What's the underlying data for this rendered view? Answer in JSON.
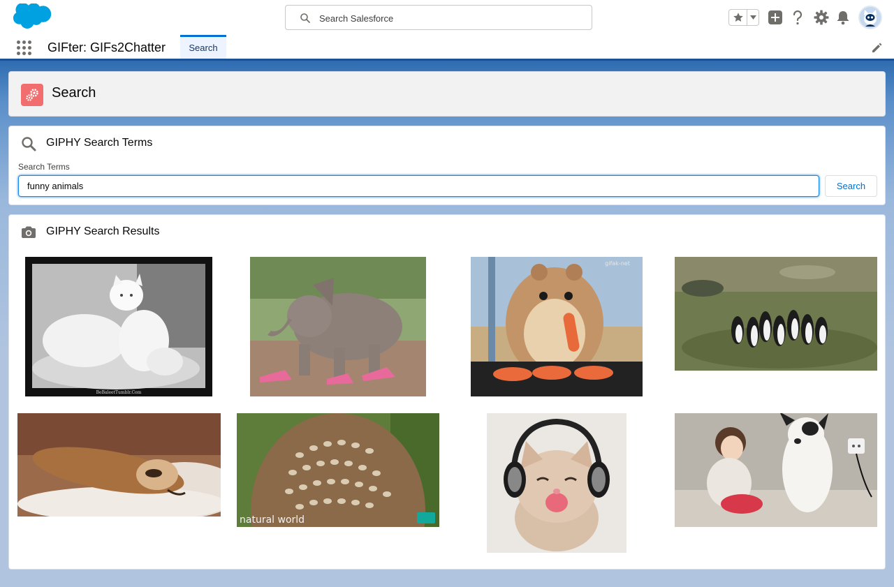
{
  "global_header": {
    "search_placeholder": "Search Salesforce",
    "icons": [
      "salesforce-logo",
      "search-icon",
      "favorites-star-icon",
      "favorites-caret-icon",
      "add-icon",
      "help-icon",
      "setup-gear-icon",
      "notifications-bell-icon",
      "user-avatar"
    ]
  },
  "nav": {
    "app_name": "GIFter: GIFs2Chatter",
    "tabs": [
      {
        "label": "Search",
        "selected": true
      }
    ]
  },
  "page_header": {
    "title": "Search"
  },
  "search_card": {
    "title": "GIPHY Search Terms",
    "field_label": "Search Terms",
    "field_value": "funny animals",
    "button_label": "Search"
  },
  "results_card": {
    "title": "GIPHY Search Results",
    "gifs": [
      {
        "subject": "white cat",
        "overlay_text": "BeBaleetTumblr.Com"
      },
      {
        "subject": "elephant in pink sneakers",
        "overlay_text": ""
      },
      {
        "subject": "hamster eating carrot",
        "overlay_text": "gifak-net"
      },
      {
        "subject": "penguins walking",
        "overlay_text": ""
      },
      {
        "subject": "sloth sleeping",
        "overlay_text": ""
      },
      {
        "subject": "owl",
        "overlay_text": "natural world"
      },
      {
        "subject": "kitten with headphones",
        "overlay_text": ""
      },
      {
        "subject": "girl and dog",
        "overlay_text": ""
      }
    ]
  },
  "colors": {
    "brand_blue": "#0070d2",
    "header_bar": "#1b5297",
    "page_icon": "#f26d6d",
    "background": "#b0c4df"
  }
}
